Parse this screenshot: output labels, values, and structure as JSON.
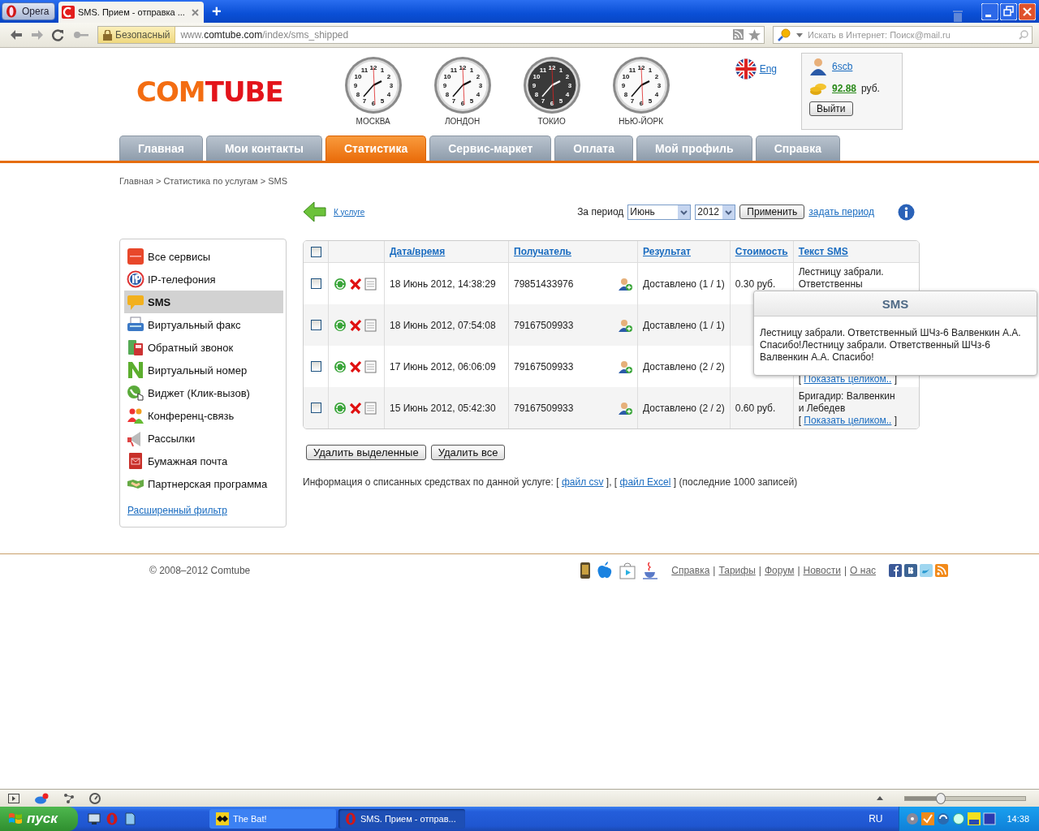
{
  "browser": {
    "menu_button": "Opera",
    "tab": {
      "title": "SMS. Прием - отправка ...",
      "selected": true
    },
    "new_tab": "+",
    "security": "Безопасный",
    "url": {
      "prefix": "www.",
      "host": "comtube.com",
      "path": "/index/sms_shipped"
    },
    "search_placeholder": "Искать в Интернет: Поиск@mail.ru"
  },
  "header": {
    "logo_a": "COM",
    "logo_b": "TUBE",
    "clocks": [
      {
        "city": "МОСКВА",
        "dark": false,
        "dial": [
          "11",
          "12",
          "1",
          "10",
          "2",
          "9",
          "3",
          "8",
          "4",
          "7",
          "6",
          "5"
        ]
      },
      {
        "city": "ЛОНДОН",
        "dark": false,
        "dial": [
          "11",
          "12",
          "1",
          "10",
          "2",
          "9",
          "3",
          "8",
          "4",
          "7",
          "6",
          "5"
        ]
      },
      {
        "city": "ТОКИО",
        "dark": true,
        "dial": [
          "11",
          "12",
          "1",
          "10",
          "2",
          "9",
          "3",
          "8",
          "4",
          "7",
          "6",
          "5"
        ]
      },
      {
        "city": "НЬЮ-ЙОРК",
        "dark": false,
        "dial": [
          "11",
          "12",
          "1",
          "10",
          "2",
          "9",
          "3",
          "8",
          "4",
          "7",
          "6",
          "5"
        ]
      }
    ],
    "language": "Eng",
    "user": {
      "name": "6scb",
      "balance": "92.88",
      "currency": "руб.",
      "logout": "Выйти"
    }
  },
  "nav": [
    {
      "label": "Главная",
      "selected": false
    },
    {
      "label": "Мои контакты",
      "selected": false
    },
    {
      "label": "Статистика",
      "selected": true
    },
    {
      "label": "Сервис-маркет",
      "selected": false
    },
    {
      "label": "Оплата",
      "selected": false
    },
    {
      "label": "Мой профиль",
      "selected": false
    },
    {
      "label": "Справка",
      "selected": false
    }
  ],
  "breadcrumb": "Главная > Статистика по услугам > SMS",
  "toolbar": {
    "back": "К услуге",
    "period_label": "За период",
    "month": "Июнь",
    "year": "2012",
    "apply": "Применить",
    "custom_period": "задать период"
  },
  "sidebar": {
    "items": [
      {
        "label": "Все сервисы",
        "selected": false
      },
      {
        "label": "IP-телефония",
        "selected": false
      },
      {
        "label": "SMS",
        "selected": true
      },
      {
        "label": "Виртуальный факс",
        "selected": false
      },
      {
        "label": "Обратный звонок",
        "selected": false
      },
      {
        "label": "Виртуальный номер",
        "selected": false
      },
      {
        "label": "Виджет (Клик-вызов)",
        "selected": false
      },
      {
        "label": "Конференц-связь",
        "selected": false
      },
      {
        "label": "Рассылки",
        "selected": false
      },
      {
        "label": "Бумажная почта",
        "selected": false
      },
      {
        "label": "Партнерская программа",
        "selected": false
      }
    ],
    "filter_link": "Расширенный фильтр"
  },
  "table": {
    "header_checked": false,
    "columns": [
      "Дата/время",
      "Получатель",
      "Результат",
      "Стоимость",
      "Текст SMS"
    ],
    "rows": [
      {
        "checked": false,
        "datetime": "18 Июнь 2012, 14:38:29",
        "recipient": "79851433976",
        "result": "Доставлено (1 / 1)",
        "cost": "0.30 руб.",
        "text_lines": [
          "Лестницу забрали.",
          "Ответственны"
        ]
      },
      {
        "checked": false,
        "datetime": "18 Июнь 2012, 07:54:08",
        "recipient": "79167509933",
        "result": "Доставлено (1 / 1)"
      },
      {
        "checked": false,
        "datetime": "17 Июнь 2012, 06:06:09",
        "recipient": "79167509933",
        "result": "Доставлено (2 / 2)",
        "show_full": {
          "open": "[",
          "label": "Показать целиком..",
          "close": "]"
        }
      },
      {
        "checked": false,
        "datetime": "15 Июнь 2012, 05:42:30",
        "recipient": "79167509933",
        "result": "Доставлено (2 / 2)",
        "cost": "0.60 руб.",
        "text_lines": [
          "Бригадир: Валвенкин",
          "и Лебедев"
        ],
        "show_full": {
          "open": "[",
          "label": "Показать целиком..",
          "close": "]"
        }
      }
    ]
  },
  "tooltip": {
    "title": "SMS",
    "text": "Лестницу забрали. Ответственный ШЧз-6 Валвенкин А.А. Спасибо!Лестницу забрали. Ответственный ШЧз-6 Валвенкин А.А. Спасибо!"
  },
  "actions": {
    "delete_selected": "Удалить выделенные",
    "delete_all": "Удалить все"
  },
  "export": {
    "prefix": "Информация о списанных средствах по данной услуге: [",
    "csv": "файл csv",
    "middle": "], [",
    "excel": "файл Excel",
    "suffix": "] (последние 1000 записей)"
  },
  "footer": {
    "copyright": "© 2008–2012 Comtube",
    "links": [
      "Справка",
      "Тарифы",
      "Форум",
      "Новости",
      "О нас"
    ],
    "separators": [
      "|",
      "|",
      "|",
      "|"
    ]
  },
  "status_bar": {
    "zoom": {
      "level": 0.3
    }
  },
  "taskbar": {
    "start": "пуск",
    "tasks": [
      {
        "label": "The Bat!",
        "selected": false
      },
      {
        "label": "SMS. Прием - отправ...",
        "selected": true
      }
    ],
    "language": "RU",
    "clock": "14:38"
  }
}
